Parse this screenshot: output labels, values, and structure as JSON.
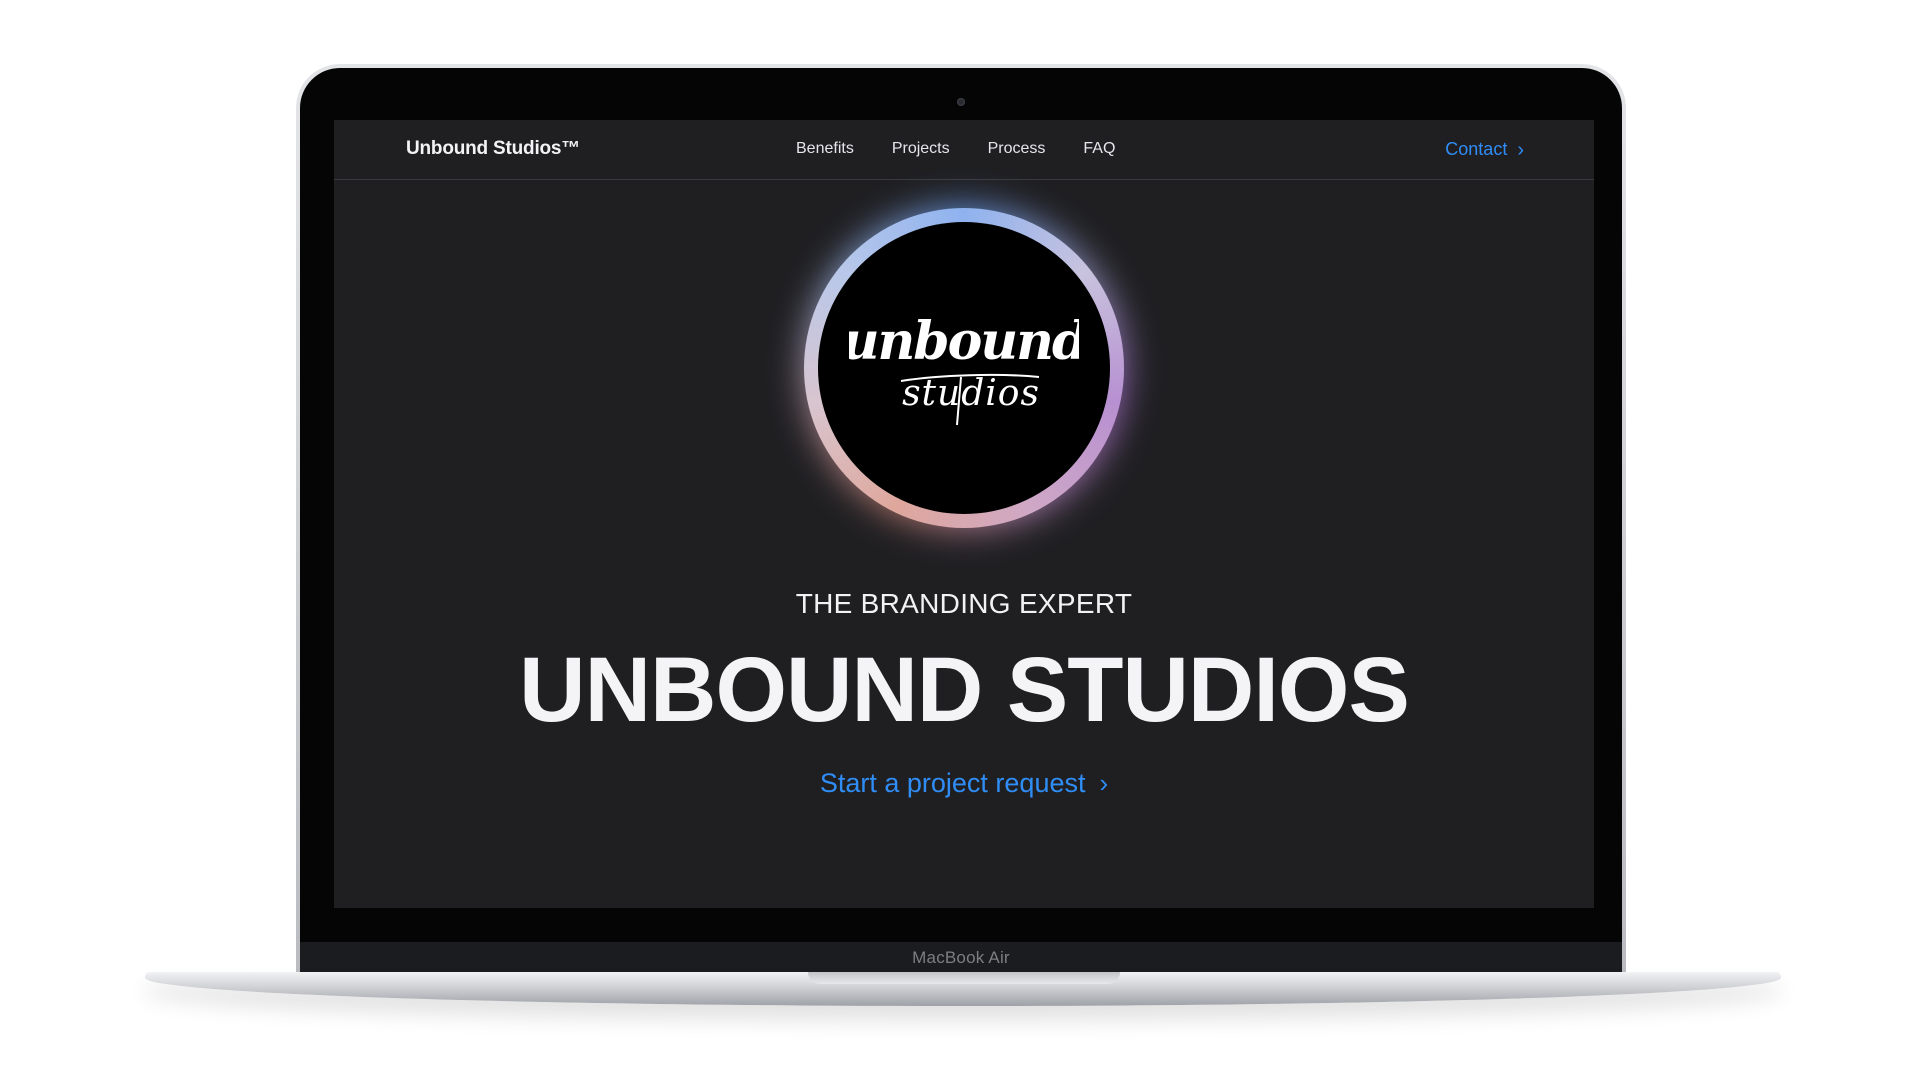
{
  "device": {
    "model_label": "MacBook Air"
  },
  "nav": {
    "brand": "Unbound Studios™",
    "links": [
      "Benefits",
      "Projects",
      "Process",
      "FAQ"
    ],
    "contact": "Contact",
    "contact_icon": "chevron-right-icon"
  },
  "hero": {
    "logo_text": "unbound studios",
    "eyebrow": "THE BRANDING EXPERT",
    "headline": "UNBOUND STUDIOS",
    "cta": "Start a project request",
    "cta_icon": "chevron-right-icon"
  },
  "colors": {
    "screen_bg": "#1f1f22",
    "link_blue": "#2f8df5",
    "text": "#f3f3f5"
  }
}
